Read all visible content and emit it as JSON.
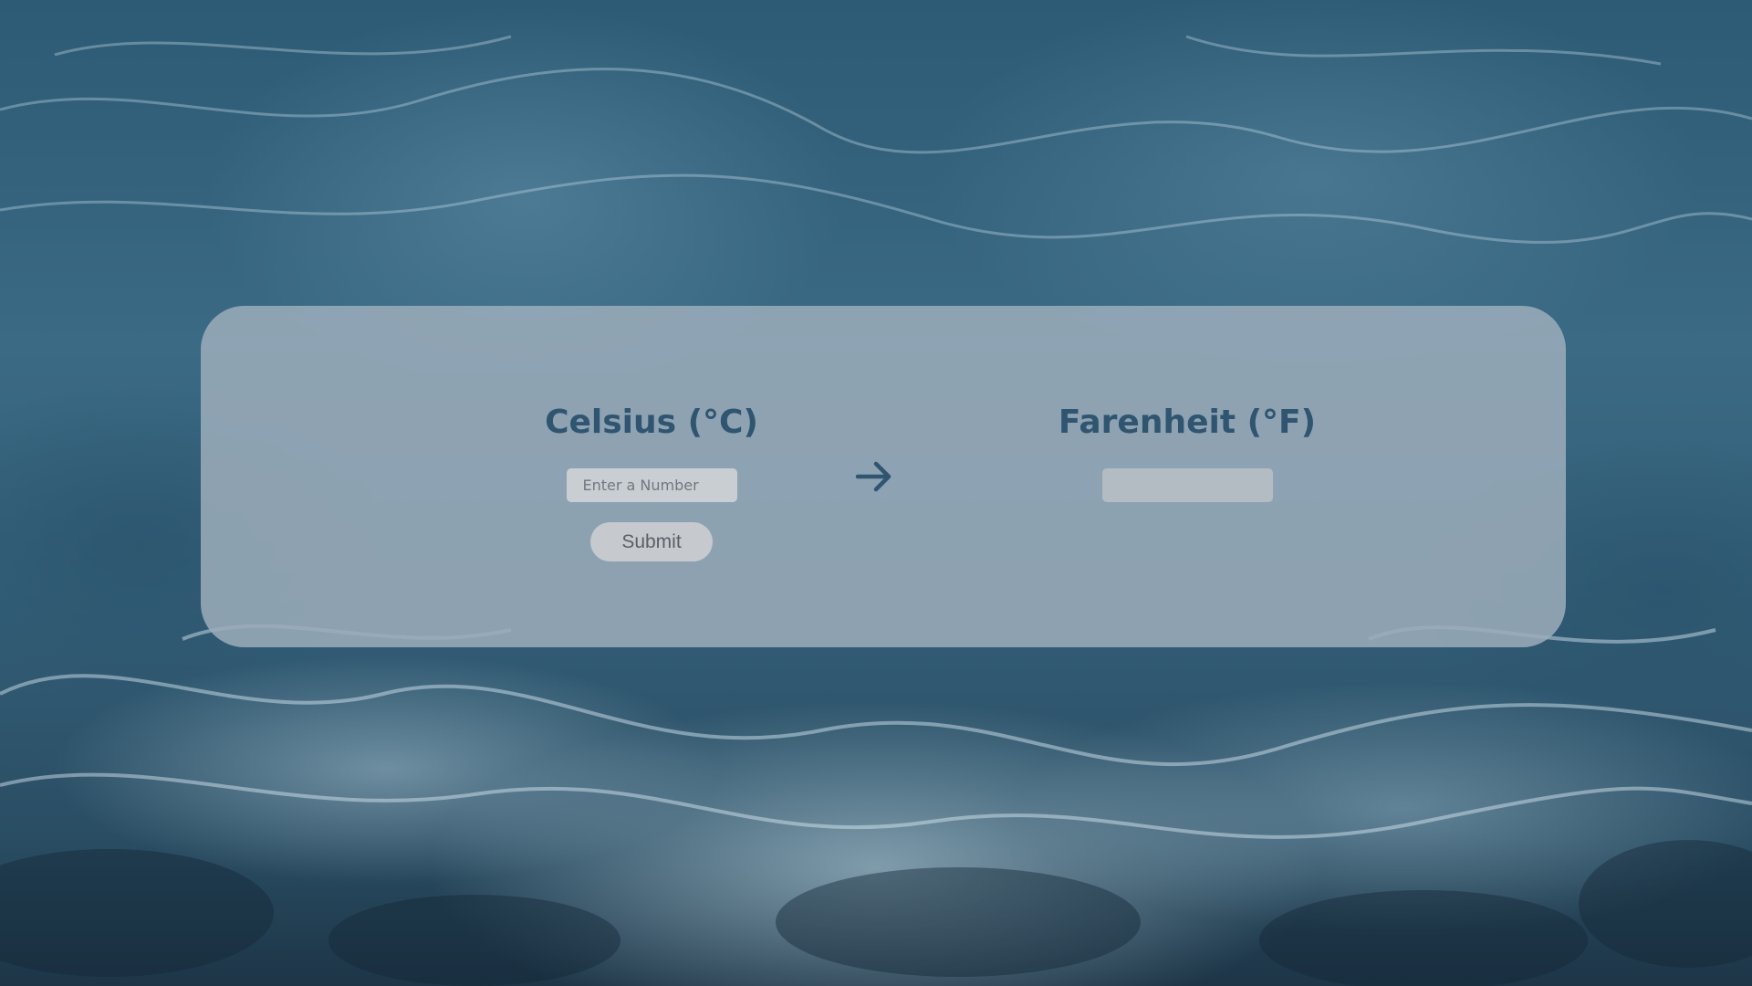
{
  "converter": {
    "from": {
      "heading": "Celsius (°C)",
      "placeholder": "Enter a Number",
      "value": ""
    },
    "to": {
      "heading": "Farenheit (°F)",
      "value": ""
    },
    "submit_label": "Submit",
    "arrow_icon": "arrow-right-icon"
  },
  "colors": {
    "heading": "#2f5570",
    "card": "#9cacba",
    "background": "#2d5a74"
  }
}
